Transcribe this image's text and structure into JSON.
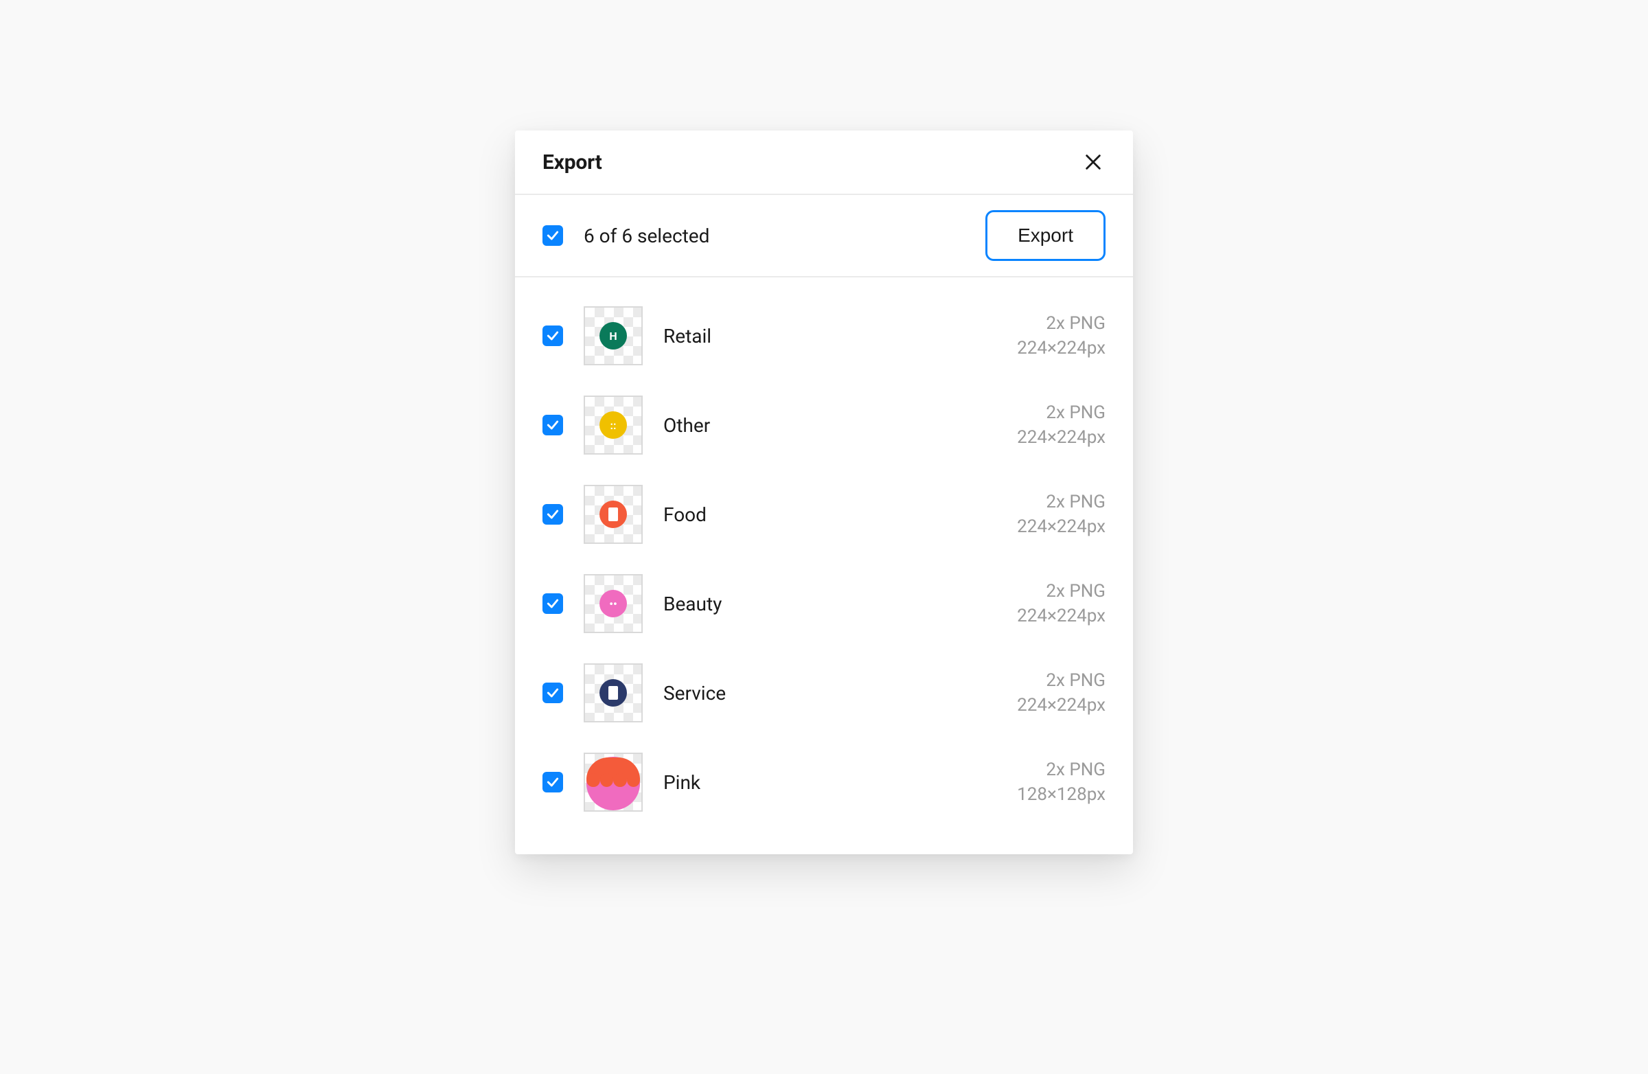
{
  "dialog": {
    "title": "Export",
    "selected_text": "6 of 6 selected",
    "export_button_label": "Export"
  },
  "items": [
    {
      "name": "Retail",
      "scale": "2x PNG",
      "dims": "224×224px",
      "thumb": {
        "kind": "small",
        "bg": "#0a7a5a",
        "glyph": "H",
        "glyphColor": "#ffffff"
      }
    },
    {
      "name": "Other",
      "scale": "2x PNG",
      "dims": "224×224px",
      "thumb": {
        "kind": "small",
        "bg": "#f0c000",
        "glyph": "::",
        "glyphColor": "#ffffff"
      }
    },
    {
      "name": "Food",
      "scale": "2x PNG",
      "dims": "224×224px",
      "thumb": {
        "kind": "small",
        "bg": "#f45b3a",
        "glyph": "",
        "glyphColor": "#ffffff",
        "innerSquare": true
      }
    },
    {
      "name": "Beauty",
      "scale": "2x PNG",
      "dims": "224×224px",
      "thumb": {
        "kind": "small",
        "bg": "#f06bbf",
        "glyph": "••",
        "glyphColor": "#ffffff"
      }
    },
    {
      "name": "Service",
      "scale": "2x PNG",
      "dims": "224×224px",
      "thumb": {
        "kind": "small",
        "bg": "#2b3a6a",
        "glyph": "",
        "glyphColor": "#ffffff",
        "innerSquare": true
      }
    },
    {
      "name": "Pink",
      "scale": "2x PNG",
      "dims": "128×128px",
      "thumb": {
        "kind": "big",
        "bg": "#f06bbf",
        "cap": "#f45b3a"
      }
    }
  ]
}
